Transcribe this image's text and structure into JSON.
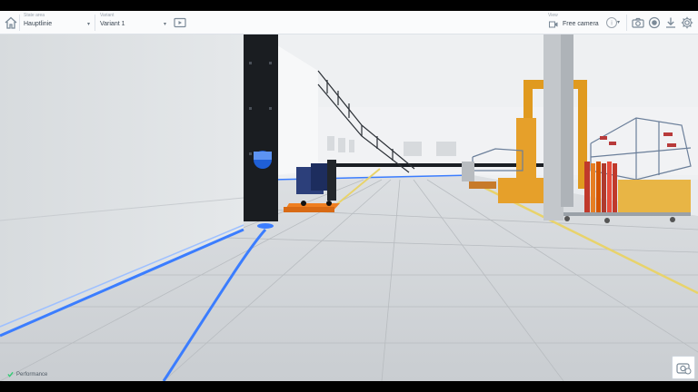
{
  "toolbar": {
    "state_area": {
      "caption": "State area",
      "value": "Hauptlinie"
    },
    "variant": {
      "caption": "Variant",
      "value": "Variant 1"
    },
    "view": {
      "caption": "View",
      "value": "Free camera"
    }
  },
  "status": {
    "performance_label": "Performance",
    "performance_color": "#2ecc71"
  },
  "icons": [
    "home-icon",
    "present-icon",
    "camera-icon",
    "record-icon",
    "download-icon",
    "settings-icon",
    "help-icon",
    "snapshot-icon"
  ]
}
